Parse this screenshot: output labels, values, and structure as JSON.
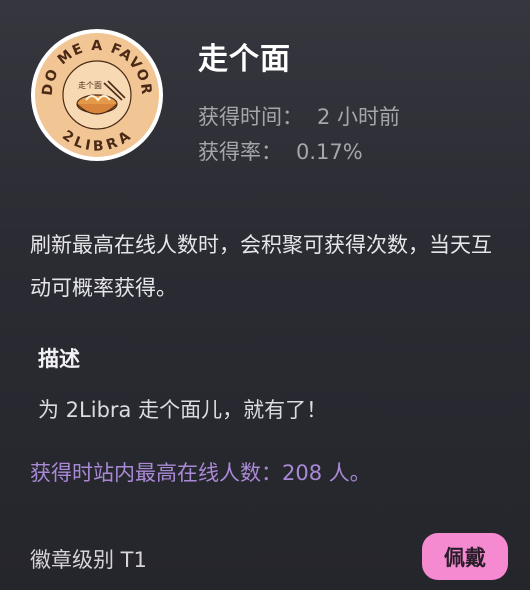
{
  "badge": {
    "emblem_text_top": "DO ME A FAVOR",
    "emblem_text_bottom": "2LIBRA",
    "emblem_center_text": "走个面",
    "colors": {
      "ring": "#f3c89a",
      "inner": "#f6d2a6",
      "text": "#4a2a16",
      "outer_border": "#ffffff"
    }
  },
  "title": "走个面",
  "meta": {
    "time_label": "获得时间：",
    "time_value": "2 小时前",
    "rate_label": "获得率：",
    "rate_value": "0.17%"
  },
  "condition": "刷新最高在线人数时，会积聚可获得次数，当天互动可概率获得。",
  "description": {
    "title": "描述",
    "text": "为 2Libra 走个面儿，就有了！"
  },
  "peak_online": "获得时站内最高在线人数：208 人。",
  "level": "徽章级别 T1",
  "wear_button": "佩戴",
  "accent_colors": {
    "purple": "#a989d6",
    "pink_button": "#f58ad0"
  }
}
